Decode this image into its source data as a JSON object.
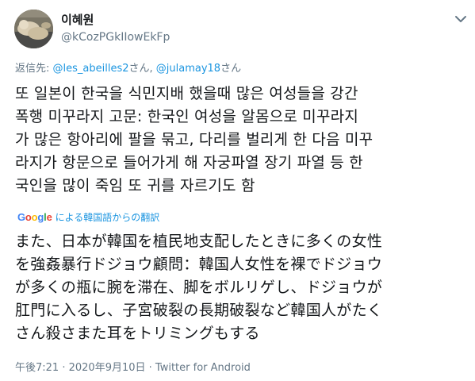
{
  "author": {
    "name": "이혜원",
    "handle": "@kCozPGkIIowEkFp"
  },
  "reply": {
    "prefix": "返信先: ",
    "mention1": "@les_abeilles2",
    "suffix1": "さん, ",
    "mention2": "@julamay18",
    "suffix2": "さん"
  },
  "tweet": {
    "original_lines": [
      "또 일본이 한국을 식민지배 했을때 많은 여성들을 강간",
      "폭행 미꾸라지 고문: 한국인 여성을 알몸으로 미꾸라지",
      "가 많은 항아리에 팔을 묶고, 다리를 벌리게 한 다음 미꾸",
      "라지가 항문으로 들어가게 해 자궁파열 장기 파열 등 한",
      "국인을 많이 죽임 또 귀를 자르기도 함"
    ],
    "translation_label": "による韓国語からの翻訳",
    "translated_lines": [
      "また、日本が韓国を植民地支配したときに多くの女性",
      "を強姦暴行ドジョウ顧問：韓国人女性を裸でドジョウ",
      "が多くの瓶に腕を滞在、脚をボルリゲし、ドジョウが",
      "肛門に入るし、子宮破裂の長期破裂など韓国人がたく",
      "さん殺さまた耳をトリミングもする"
    ]
  },
  "meta": {
    "time": "午後7:21",
    "separator": " · ",
    "date": "2020年9月10日",
    "separator2": " · ",
    "source": "Twitter for Android"
  },
  "icons": {
    "avatar": "avatar-image",
    "menu": "chevron-down-icon"
  },
  "colors": {
    "text": "#14171a",
    "muted": "#657786",
    "link": "#1b95e0"
  }
}
